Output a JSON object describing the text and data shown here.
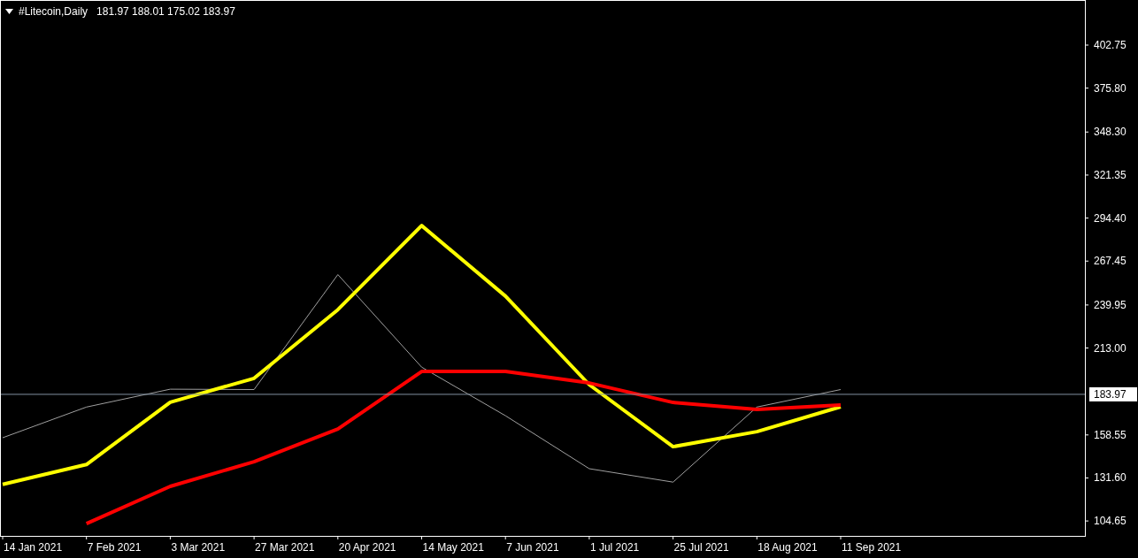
{
  "header": {
    "symbol": "#Litecoin,Daily",
    "ohlc": [
      "181.97",
      "188.01",
      "175.02",
      "183.97"
    ]
  },
  "chart_data": {
    "type": "line",
    "categories": [
      "14 Jan 2021",
      "7 Feb 2021",
      "3 Mar 2021",
      "27 Mar 2021",
      "20 Apr 2021",
      "14 May 2021",
      "7 Jun 2021",
      "1 Jul 2021",
      "25 Jul 2021",
      "18 Aug 2021",
      "11 Sep 2021"
    ],
    "series": [
      {
        "color": "#a0a0a0",
        "values": [
          156.8,
          176,
          187.2,
          187,
          259,
          201,
          170.6,
          137.4,
          129,
          176,
          187
        ]
      },
      {
        "color": "#ffff00",
        "values": [
          127.6,
          140,
          179,
          194,
          237,
          289.7,
          245.5,
          190,
          151.2,
          160.6,
          176.2
        ]
      },
      {
        "color": "#ff0000",
        "values": [
          null,
          103,
          126.3,
          141.8,
          162.3,
          198.3,
          198.3,
          191.1,
          178.9,
          174.5,
          177.3
        ]
      }
    ],
    "ylim": [
      95.3,
      431
    ],
    "yticks": [
      {
        "value": 402.75,
        "label": "402.75"
      },
      {
        "value": 375.8,
        "label": "375.80"
      },
      {
        "value": 348.3,
        "label": "348.30"
      },
      {
        "value": 321.35,
        "label": "321.35"
      },
      {
        "value": 294.4,
        "label": "294.40"
      },
      {
        "value": 267.45,
        "label": "267.45"
      },
      {
        "value": 239.95,
        "label": "239.95"
      },
      {
        "value": 213,
        "label": "213.00"
      },
      {
        "value": 158.55,
        "label": "158.55"
      },
      {
        "value": 131.6,
        "label": "131.60"
      },
      {
        "value": 104.65,
        "label": "104.65"
      }
    ],
    "ref_lines": [
      {
        "axis": "y",
        "value": 183.97,
        "label": "183.97"
      }
    ]
  }
}
